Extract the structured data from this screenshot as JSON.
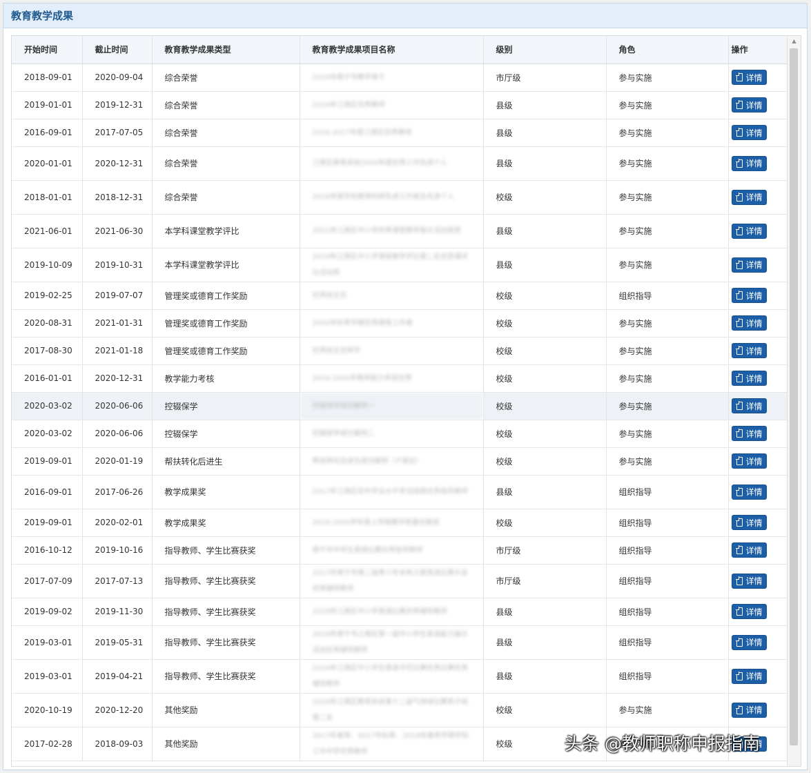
{
  "panel": {
    "title": "教育教学成果"
  },
  "table": {
    "columns": [
      "开始时间",
      "截止时间",
      "教育教学成果类型",
      "教育教学成果项目名称",
      "级别",
      "角色",
      "操作"
    ],
    "action_label": "详情",
    "rows": [
      {
        "start": "2018-09-01",
        "end": "2020-09-04",
        "type": "综合荣誉",
        "name": "2020年南宁市教学骨干",
        "level": "市厅级",
        "role": "参与实施"
      },
      {
        "start": "2019-01-01",
        "end": "2019-12-31",
        "type": "综合荣誉",
        "name": "2019年江南区优秀教师",
        "level": "县级",
        "role": "参与实施"
      },
      {
        "start": "2016-09-01",
        "end": "2017-07-05",
        "type": "综合荣誉",
        "name": "2016-2017年度江南区优秀教师",
        "level": "县级",
        "role": "参与实施"
      },
      {
        "start": "2020-01-01",
        "end": "2020-12-31",
        "type": "综合荣誉",
        "name": "江南区教育系统2020年度优秀工作先进个人",
        "level": "县级",
        "role": "参与实施"
      },
      {
        "start": "2018-01-01",
        "end": "2018-12-31",
        "type": "综合荣誉",
        "name": "2018年度学校教育科研先进工作者及先进个人",
        "level": "校级",
        "role": "参与实施"
      },
      {
        "start": "2021-06-01",
        "end": "2021-06-30",
        "type": "本学科课堂教学评比",
        "name": "2021年江南区中小学优秀课堂教学展示活动获奖",
        "level": "县级",
        "role": "参与实施"
      },
      {
        "start": "2019-10-09",
        "end": "2019-10-31",
        "type": "本学科课堂教学评比",
        "name": "2019年江南区中小学课堂教学评比第二名优质课评比活动奖",
        "level": "县级",
        "role": "参与实施"
      },
      {
        "start": "2019-02-25",
        "end": "2019-07-07",
        "type": "管理奖或德育工作奖励",
        "name": "优秀班主任",
        "level": "校级",
        "role": "组织指导"
      },
      {
        "start": "2020-08-31",
        "end": "2021-01-31",
        "type": "管理奖或德育工作奖励",
        "name": "2020年秋季学期优秀德育工作者",
        "level": "校级",
        "role": "参与实施"
      },
      {
        "start": "2017-08-30",
        "end": "2021-01-18",
        "type": "管理奖或德育工作奖励",
        "name": "优秀班主任称号",
        "level": "校级",
        "role": "参与实施"
      },
      {
        "start": "2016-01-01",
        "end": "2020-12-31",
        "type": "教学能力考核",
        "name": "2016-2020年教师能力考核优秀",
        "level": "校级",
        "role": "参与实施"
      },
      {
        "start": "2020-03-02",
        "end": "2020-06-06",
        "type": "控辍保学",
        "name": "控辍保学成功案例一",
        "level": "校级",
        "role": "参与实施"
      },
      {
        "start": "2020-03-02",
        "end": "2020-06-06",
        "type": "控辍保学",
        "name": "控辍保学成功案例二",
        "level": "校级",
        "role": "参与实施"
      },
      {
        "start": "2019-09-01",
        "end": "2020-01-19",
        "type": "帮扶转化后进生",
        "name": "帮扶转化后进生成功案例（卢某伦）",
        "level": "校级",
        "role": "参与实施"
      },
      {
        "start": "2016-09-01",
        "end": "2017-06-26",
        "type": "教学成果奖",
        "name": "2017年江南区初中学业水平考试成绩优秀指导教师",
        "level": "县级",
        "role": "组织指导"
      },
      {
        "start": "2019-09-01",
        "end": "2020-02-01",
        "type": "教学成果奖",
        "name": "2019-2020学年度上学期教学质量优胜奖",
        "level": "校级",
        "role": "组织指导"
      },
      {
        "start": "2016-10-12",
        "end": "2019-10-16",
        "type": "指导教师、学生比赛获奖",
        "name": "南宁市中学生英语比赛优秀指导教师",
        "level": "市厅级",
        "role": "组织指导"
      },
      {
        "start": "2017-07-09",
        "end": "2017-07-13",
        "type": "指导教师、学生比赛获奖",
        "name": "2017年南宁市第二届青少年未来之星英语比赛大会优秀辅导教师",
        "level": "市厅级",
        "role": "组织指导"
      },
      {
        "start": "2019-09-02",
        "end": "2019-11-30",
        "type": "指导教师、学生比赛获奖",
        "name": "2019年江南区中小学英语比赛优秀辅导教师",
        "level": "县级",
        "role": "组织指导"
      },
      {
        "start": "2019-03-01",
        "end": "2019-05-31",
        "type": "指导教师、学生比赛获奖",
        "name": "2019年南宁市江南区第一届中小学生英语能力展示活动优秀辅导教师",
        "level": "县级",
        "role": "组织指导"
      },
      {
        "start": "2019-03-01",
        "end": "2019-04-21",
        "type": "指导教师、学生比赛获奖",
        "name": "2019年江南区中小学生英语书写比赛优秀比赛优秀辅导教师",
        "level": "县级",
        "role": "组织指导"
      },
      {
        "start": "2020-10-19",
        "end": "2020-12-20",
        "type": "其他奖励",
        "name": "2020年江南区教育系统第十二届气排球比赛男子组第二名",
        "level": "校级",
        "role": "参与实施"
      },
      {
        "start": "2017-02-28",
        "end": "2018-09-03",
        "type": "其他奖励",
        "name": "2017年春季、2017年秋季、2018年春季学期学校工作中学优秀教师",
        "level": "校级",
        "role": "参与实施"
      }
    ]
  },
  "watermark": "头条 @教师职称申报指南"
}
